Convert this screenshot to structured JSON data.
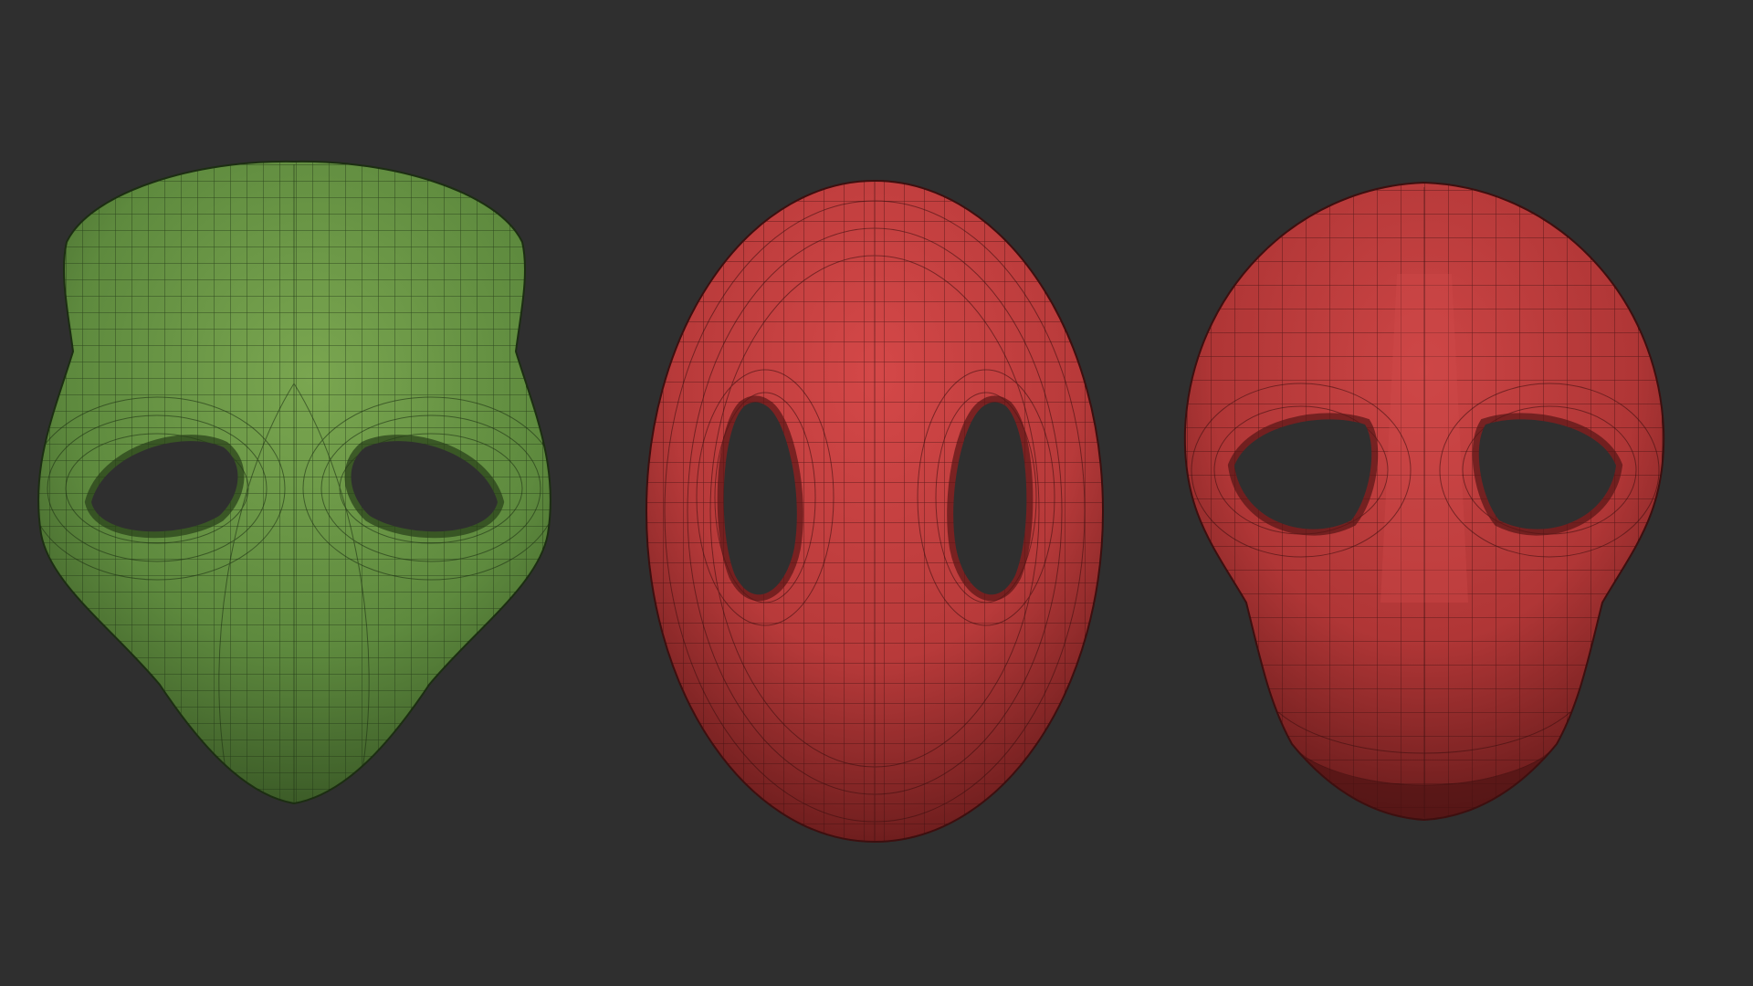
{
  "scene": {
    "background_color": "#2f2f2f",
    "meshes": [
      {
        "name": "green-mask-mesh",
        "color": "#5e8a3e",
        "highlight": "#7aa650",
        "shadow": "#2f4a1f",
        "wire": "#1f3314"
      },
      {
        "name": "red-oval-mask-mesh",
        "color": "#b83a3a",
        "highlight": "#d44848",
        "shadow": "#5a1616",
        "wire": "#3a0e0e"
      },
      {
        "name": "red-skull-mask-mesh",
        "color": "#b03636",
        "highlight": "#cc4545",
        "shadow": "#561515",
        "wire": "#3a0e0e"
      }
    ]
  }
}
